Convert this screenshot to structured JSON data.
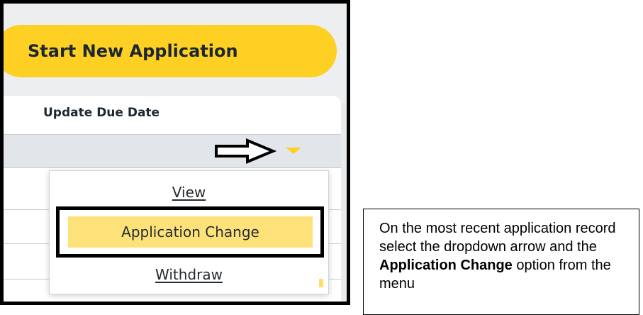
{
  "screenshot": {
    "start_button_label": "Start New Application",
    "table_header": "Update Due Date",
    "dropdown_icon": "caret-down-icon",
    "annotation_arrow_icon": "right-arrow-icon",
    "menu": {
      "items": [
        {
          "label": "View"
        },
        {
          "label": "Application Change"
        },
        {
          "label": "Withdraw"
        }
      ]
    }
  },
  "callout": {
    "text_1": "On the most recent application record select the dropdown arrow and the ",
    "bold_1": "Application Change",
    "text_2": " option from the menu"
  },
  "colors": {
    "accent_yellow": "#fdd023",
    "highlight_yellow": "#fde27a",
    "frame_border": "#000000",
    "selected_row": "#e2e5e9"
  }
}
